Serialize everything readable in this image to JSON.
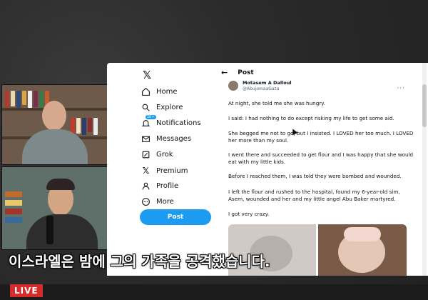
{
  "twitter": {
    "nav": [
      {
        "label": "Home",
        "icon": "home-icon"
      },
      {
        "label": "Explore",
        "icon": "search-icon"
      },
      {
        "label": "Notifications",
        "icon": "bell-icon",
        "badge": "20+"
      },
      {
        "label": "Messages",
        "icon": "mail-icon"
      },
      {
        "label": "Grok",
        "icon": "grok-icon"
      },
      {
        "label": "Premium",
        "icon": "x-icon"
      },
      {
        "label": "Profile",
        "icon": "person-icon"
      },
      {
        "label": "More",
        "icon": "more-circle-icon"
      }
    ],
    "post_button": "Post",
    "header_title": "Post",
    "author_name": "Motasem A Dalloul",
    "author_handle": "@AbujomaaGaza",
    "paragraphs": [
      "At night, she told me she was hungry.",
      "I said: I had nothing to do except risking my life to get some aid.",
      "She begged me not to go, but I insisted. I LOVED her too much. I LOVED her more than my soul.",
      "I went there and succeeded to get flour and I was happy that she would eat with my little kids.",
      "Before I reached them, I was told they were bombed and wounded.",
      "I left the flour and rushed to the hospital, found my 6-year-old sim, Asem, wounded and her and my little angel Abu Baker martyred.",
      "I got very crazy."
    ]
  },
  "subtitle": "이스라엘은 밤에 그의 가족을 공격했습니다.",
  "live_label": "LIVE",
  "colors": {
    "accent": "#1d9bf0",
    "live": "#d62b2b"
  }
}
